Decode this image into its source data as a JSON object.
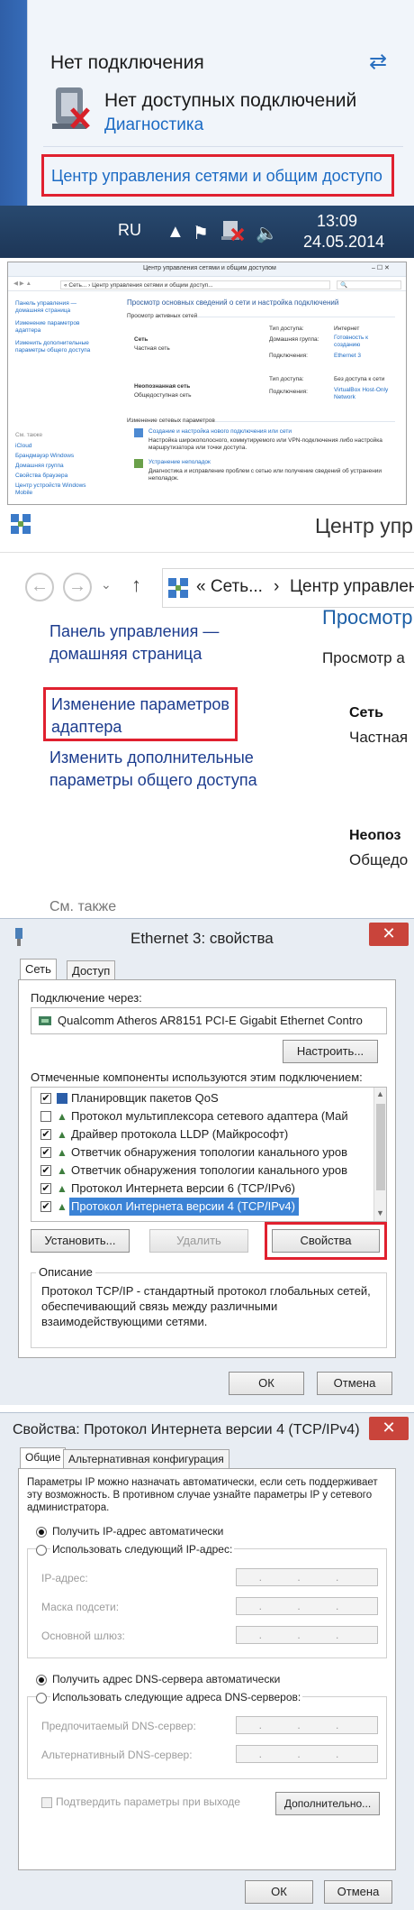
{
  "popup": {
    "title": "Нет подключения",
    "no_connections": "Нет доступных подключений",
    "diagnostics": "Диагностика",
    "network_center_link": "Центр управления сетями и общим доступо"
  },
  "taskbar": {
    "language": "RU",
    "time": "13:09",
    "date": "24.05.2014"
  },
  "small_panel": {
    "window_title": "Центр управления сетями и общим доступом",
    "address": "« Сеть... › Центр управления сетями и общим доступ...",
    "sidebar": [
      "Панель управления — домашняя страница",
      "Изменение параметров адаптера",
      "Изменить дополнительные параметры общего доступа"
    ],
    "see_also_label": "См. также",
    "see_also": [
      "iCloud",
      "Брандмауэр Windows",
      "Домашняя группа",
      "Свойства браузера",
      "Центр устройств Windows Mobile"
    ],
    "main_heading": "Просмотр основных сведений о сети и настройка подключений",
    "active_networks": "Просмотр активных сетей",
    "net1_name": "Сеть",
    "net1_type": "Частная сеть",
    "net2_name": "Неопознанная сеть",
    "net2_type": "Общедоступная сеть",
    "access_type": "Тип доступа:",
    "access_internet": "Интернет",
    "access_none": "Без доступа к сети",
    "homegroup": "Домашняя группа:",
    "homegroup_ready": "Готовность к созданию",
    "connections": "Подключения:",
    "conn1": "Ethernet 3",
    "conn2": "VirtualBox Host-Only Network",
    "change_settings": "Изменение сетевых параметров",
    "new_connection": "Создание и настройка нового подключения или сети",
    "new_connection_desc": "Настройка широкополосного, коммутируемого или VPN-подключения либо настройка маршрутизатора или точки доступа.",
    "troubleshoot": "Устранение неполадок",
    "troubleshoot_desc": "Диагностика и исправление проблем с сетью или получение сведений об устранении неполадок."
  },
  "zoom_panel": {
    "title": "Центр упр",
    "crumb1": "« Сеть...",
    "crumb2": "Центр управлен",
    "home_link": "Панель управления — домашняя страница",
    "adapter_link": "Изменение параметров адаптера",
    "sharing_link": "Изменить дополнительные параметры общего доступа",
    "see_also": "См. также",
    "heading": "Просмотр",
    "sub": "Просмотр а",
    "net": "Сеть",
    "private": "Частная",
    "unknown": "Неопоз",
    "public": "Общедо"
  },
  "eth_dialog": {
    "title": "Ethernet 3: свойства",
    "close": "✕",
    "tabs": [
      "Сеть",
      "Доступ"
    ],
    "connect_via_label": "Подключение через:",
    "adapter_name": "Qualcomm Atheros AR8151 PCI-E Gigabit Ethernet Contro",
    "configure_btn": "Настроить...",
    "components_label": "Отмеченные компоненты используются этим подключением:",
    "components": [
      {
        "label": "Планировщик пакетов QoS",
        "checked": true
      },
      {
        "label": "Протокол мультиплексора сетевого адаптера (Май",
        "checked": false
      },
      {
        "label": "Драйвер протокола LLDP (Майкрософт)",
        "checked": true
      },
      {
        "label": "Ответчик обнаружения топологии канального уров",
        "checked": true
      },
      {
        "label": "Ответчик обнаружения топологии канального уров",
        "checked": true
      },
      {
        "label": "Протокол Интернета версии 6 (TCP/IPv6)",
        "checked": true
      },
      {
        "label": "Протокол Интернета версии 4 (TCP/IPv4)",
        "checked": true
      }
    ],
    "install_btn": "Установить...",
    "remove_btn": "Удалить",
    "properties_btn": "Свойства",
    "description_label": "Описание",
    "description": "Протокол TCP/IP - стандартный протокол глобальных сетей, обеспечивающий связь между различными взаимодействующими сетями.",
    "ok_btn": "ОК",
    "cancel_btn": "Отмена"
  },
  "ipv4_dialog": {
    "title": "Свойства: Протокол Интернета версии 4 (TCP/IPv4)",
    "close": "✕",
    "tabs": [
      "Общие",
      "Альтернативная конфигурация"
    ],
    "intro": "Параметры IP можно назначать автоматически, если сеть поддерживает эту возможность. В противном случае узнайте параметры IP у сетевого администратора.",
    "auto_ip": "Получить IP-адрес автоматически",
    "manual_ip": "Использовать следующий IP-адрес:",
    "ip_label": "IP-адрес:",
    "mask_label": "Маска подсети:",
    "gateway_label": "Основной шлюз:",
    "auto_dns": "Получить адрес DNS-сервера автоматически",
    "manual_dns": "Использовать следующие адреса DNS-серверов:",
    "pref_dns": "Предпочитаемый DNS-сервер:",
    "alt_dns": "Альтернативный DNS-сервер:",
    "validate": "Подтвердить параметры при выходе",
    "advanced_btn": "Дополнительно...",
    "ok_btn": "ОК",
    "cancel_btn": "Отмена",
    "ip_placeholder": ". . ."
  }
}
